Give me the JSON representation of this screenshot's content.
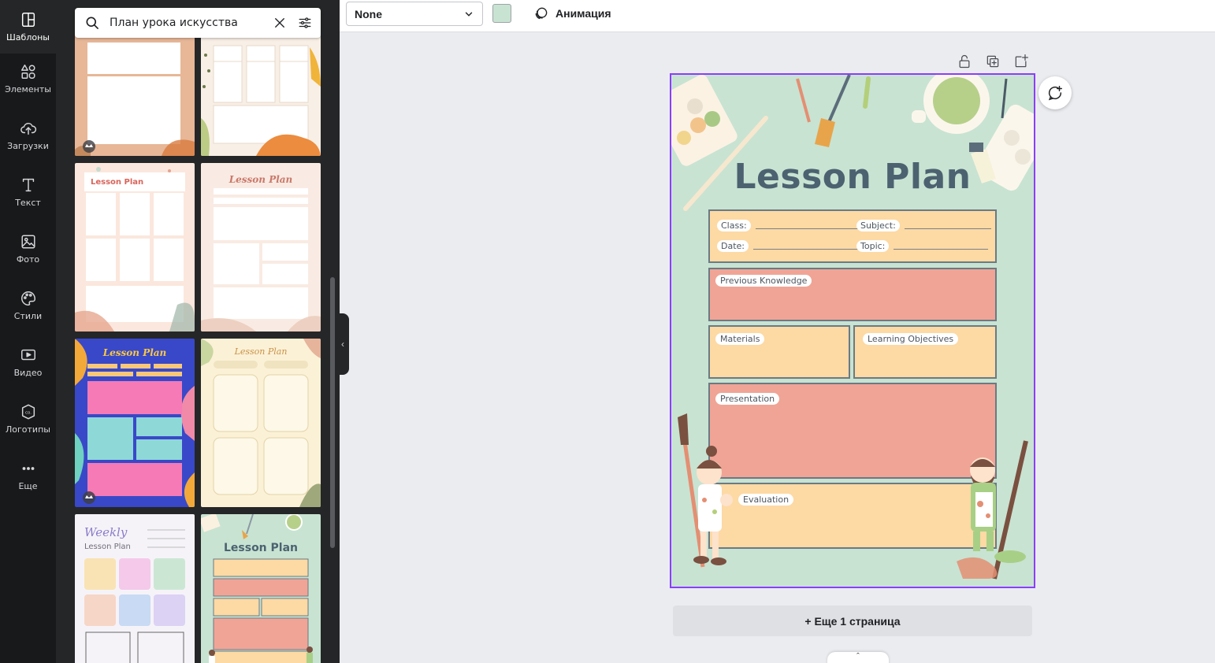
{
  "rail": {
    "items": [
      {
        "label": "Шаблоны",
        "icon": "templates-icon"
      },
      {
        "label": "Элементы",
        "icon": "elements-icon"
      },
      {
        "label": "Загрузки",
        "icon": "uploads-icon"
      },
      {
        "label": "Текст",
        "icon": "text-icon"
      },
      {
        "label": "Фото",
        "icon": "photo-icon"
      },
      {
        "label": "Стили",
        "icon": "styles-icon"
      },
      {
        "label": "Видео",
        "icon": "video-icon"
      },
      {
        "label": "Логотипы",
        "icon": "logos-icon"
      },
      {
        "label": "Еще",
        "icon": "more-icon"
      }
    ]
  },
  "search": {
    "value": "План урока искусства"
  },
  "thumbnails": {
    "t3_title": "Lesson Plan",
    "t4_title": "Lesson Plan",
    "t5_title": "Lesson Plan",
    "t6_title": "Lesson Plan",
    "t7_title_a": "Weekly",
    "t7_title_b": "Lesson Plan",
    "t8_title": "Lesson Plan"
  },
  "toolbar": {
    "select_value": "None",
    "swatch_color": "#c8e3d2",
    "animation_label": "Анимация"
  },
  "page": {
    "title": "Lesson Plan",
    "class_label": "Class:",
    "subject_label": "Subject:",
    "date_label": "Date:",
    "topic_label": "Topic:",
    "previous_knowledge": "Previous Knowledge",
    "materials": "Materials",
    "learning_objectives": "Learning Objectives",
    "presentation": "Presentation",
    "evaluation": "Evaluation"
  },
  "add_page_label": "+ Еще 1 страница",
  "colors": {
    "accent": "#8b3dff",
    "page_bg": "#c8e3d2",
    "peach": "#fdd9a4",
    "salmon": "#f0a496"
  }
}
